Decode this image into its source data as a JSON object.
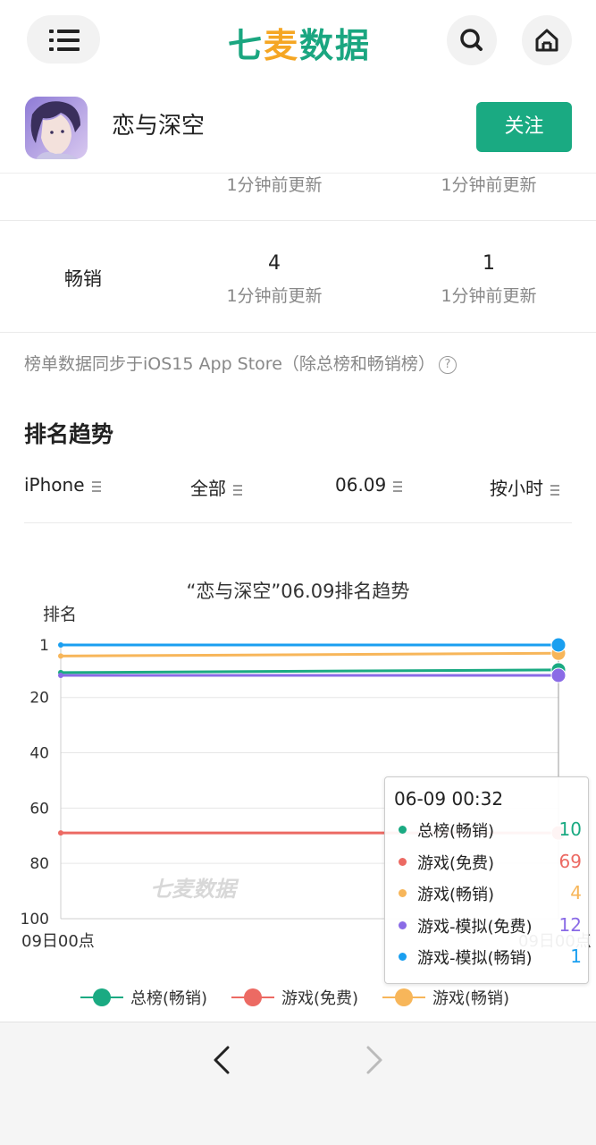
{
  "header": {
    "logo_main": "七",
    "logo_accent": "麦",
    "logo_rest": "数据",
    "menu_icon": "list-icon",
    "search_icon": "search-icon",
    "home_icon": "home-icon"
  },
  "app": {
    "name": "恋与深空",
    "follow_label": "关注"
  },
  "rank_rows": [
    {
      "label": "",
      "col1_value": "",
      "col1_updated": "1分钟前更新",
      "col2_value": "",
      "col2_updated": "1分钟前更新"
    },
    {
      "label": "畅销",
      "col1_value": "4",
      "col1_updated": "1分钟前更新",
      "col2_value": "1",
      "col2_updated": "1分钟前更新"
    }
  ],
  "note": "榜单数据同步于iOS15 App Store（除总榜和畅销榜）",
  "trend": {
    "title": "排名趋势",
    "filters": [
      "iPhone",
      "全部",
      "06.09",
      "按小时"
    ]
  },
  "chart_data": {
    "type": "line",
    "title": "“恋与深空”06.09排名趋势",
    "ylabel": "排名",
    "y_inverted": true,
    "ylim": [
      1,
      100
    ],
    "y_ticks": [
      "1",
      "20",
      "40",
      "60",
      "80",
      "100"
    ],
    "x_labels": [
      "09日00点",
      "09日00点"
    ],
    "watermark": "七麦数据",
    "series": [
      {
        "name": "总榜(畅销)",
        "color": "#1aaa82",
        "values": [
          11,
          10
        ]
      },
      {
        "name": "游戏(免费)",
        "color": "#ec6a63",
        "values": [
          69,
          69
        ]
      },
      {
        "name": "游戏(畅销)",
        "color": "#f7b65a",
        "values": [
          5,
          4
        ]
      },
      {
        "name": "游戏-模拟(免费)",
        "color": "#8a6be6",
        "values": [
          12,
          12
        ]
      },
      {
        "name": "游戏-模拟(畅销)",
        "color": "#1a9ff0",
        "values": [
          1,
          1
        ]
      }
    ],
    "tooltip": {
      "time": "06-09 00:32",
      "values": [
        "10",
        "69",
        "4",
        "12",
        "1"
      ]
    },
    "legend_visible": [
      "总榜(畅销)",
      "游戏(免费)",
      "游戏(畅销)"
    ]
  },
  "nav": {
    "back_icon": "chevron-left-icon",
    "forward_icon": "chevron-right-icon"
  }
}
